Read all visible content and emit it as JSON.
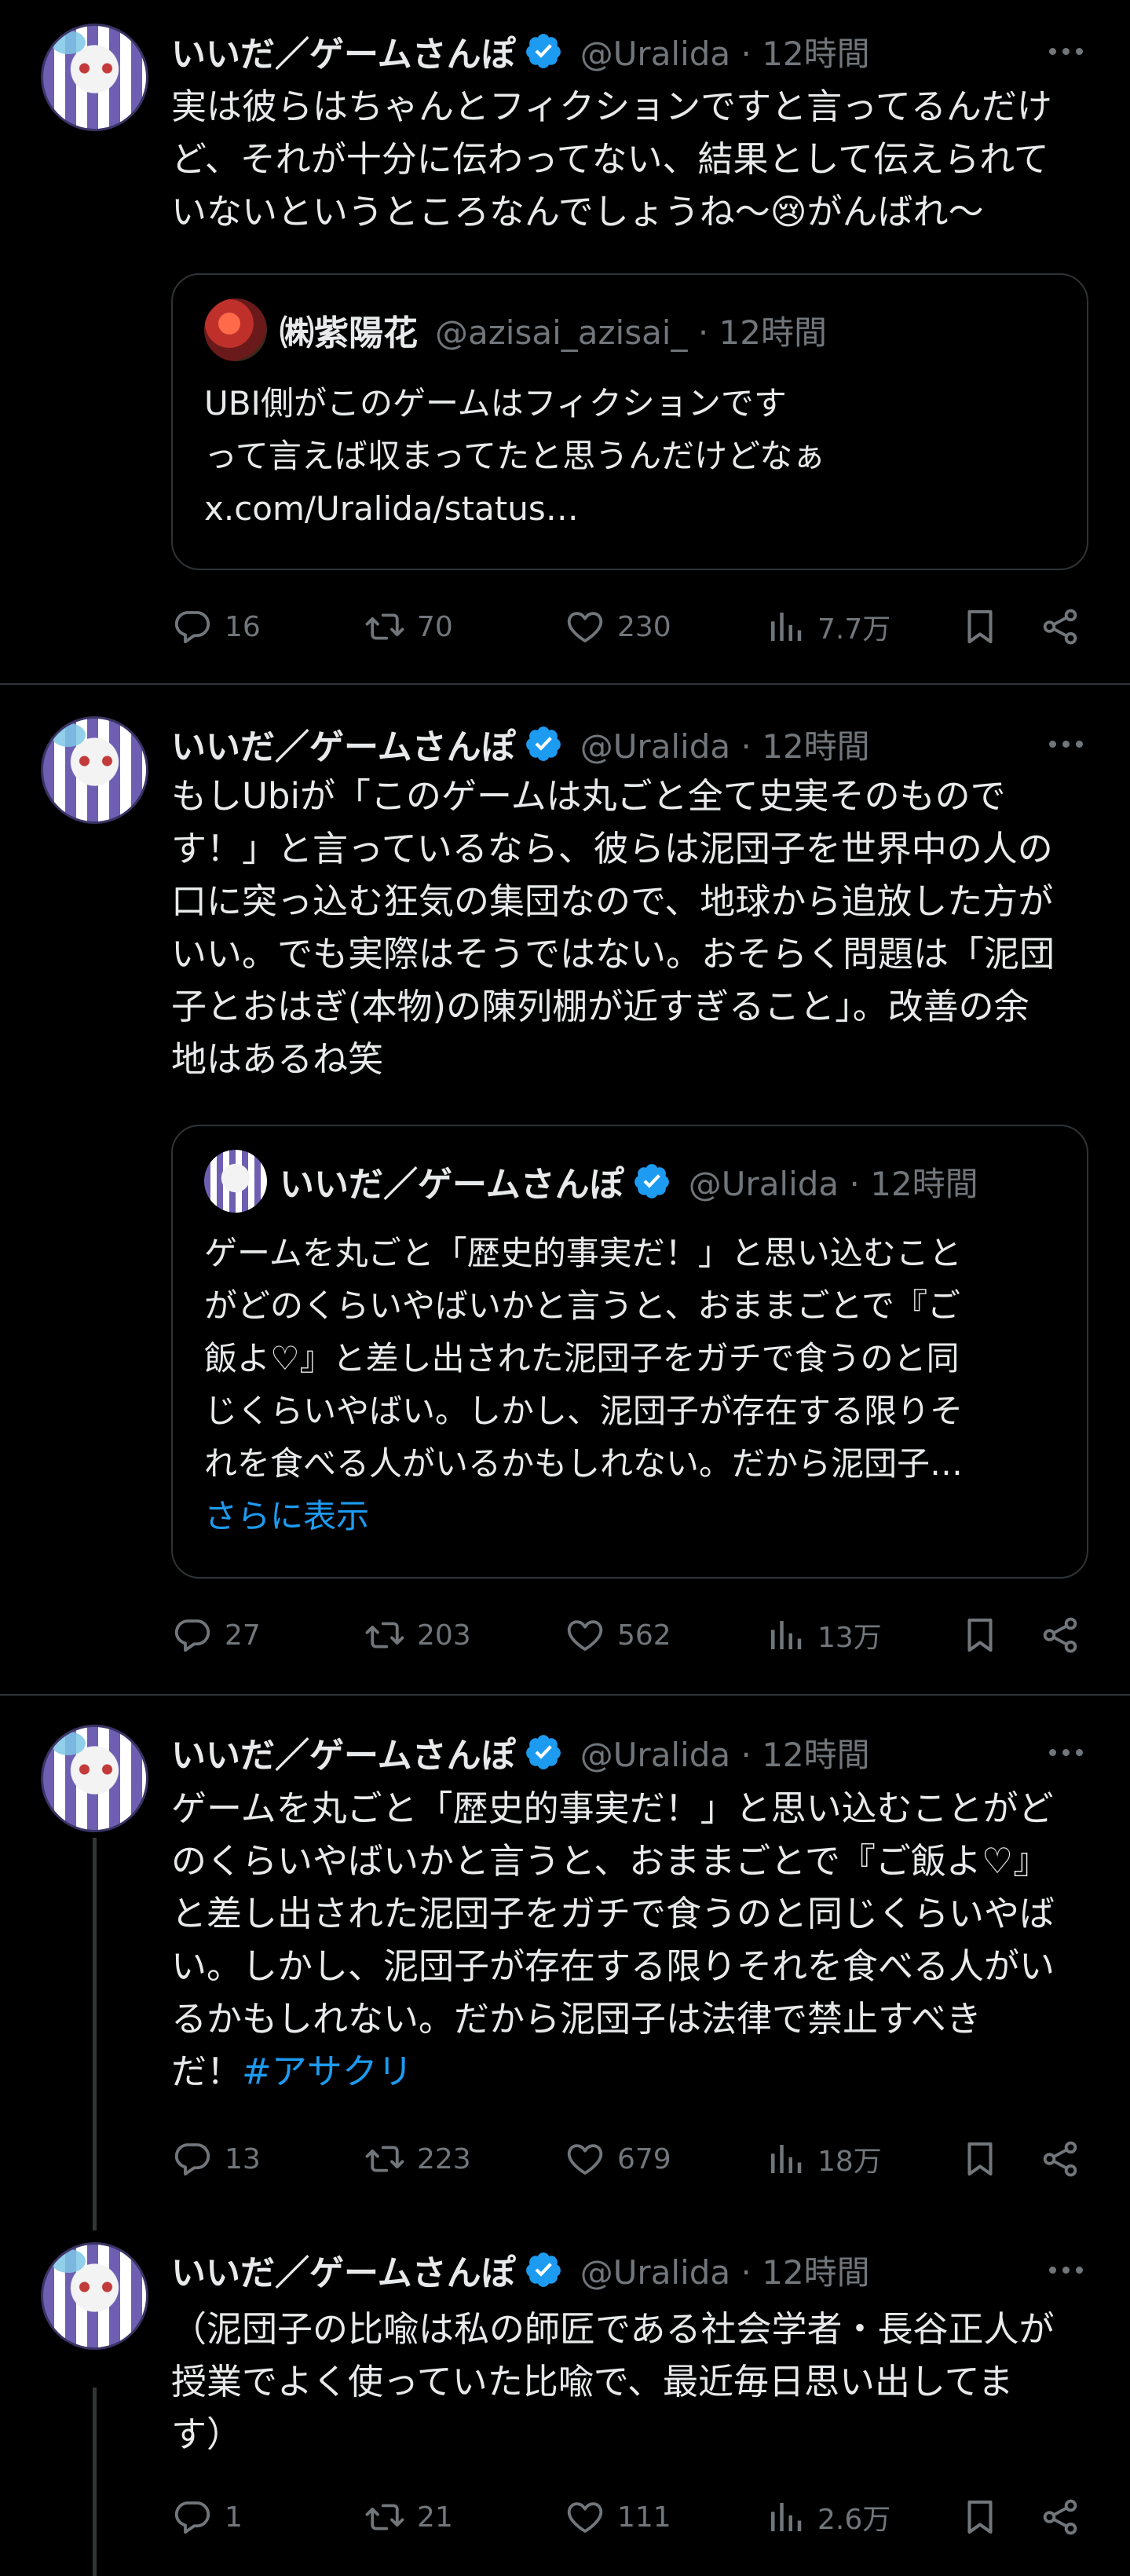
{
  "colors": {
    "background": "#000000",
    "text": "#e7e9ea",
    "secondary": "#71767b",
    "accent": "#1d9bf0",
    "border": "#2f3336"
  },
  "tweets": [
    {
      "name": "いいだ／ゲームさんぽ",
      "handle": "@Uralida · 12時間",
      "text": [
        "実は彼らはちゃんとフィクションですと言ってるんだけ",
        "ど、それが十分に伝わってない、結果として伝えられて",
        "いないというところなんでしょうね〜😢がんばれ〜"
      ],
      "quote": {
        "name": "㈱紫陽花",
        "handle": "@azisai_azisai_ · 12時間",
        "text": [
          "UBI側がこのゲームはフィクションです",
          "って言えば収まってたと思うんだけどなぁ",
          "x.com/Uralida/status…"
        ]
      },
      "stats": {
        "replies": "16",
        "retweets": "70",
        "likes": "230",
        "views": "7.7万"
      }
    },
    {
      "name": "いいだ／ゲームさんぽ",
      "handle": "@Uralida · 12時間",
      "text": [
        "もしUbiが「このゲームは丸ごと全て史実そのもので",
        "す！」と言っているなら、彼らは泥団子を世界中の人の",
        "口に突っ込む狂気の集団なので、地球から追放した方が",
        "いい。でも実際はそうではない。おそらく問題は「泥団",
        "子とおはぎ(本物)の陳列棚が近すぎること」。改善の余",
        "地はあるね笑"
      ],
      "quote": {
        "name": "いいだ／ゲームさんぽ",
        "handle": "@Uralida · 12時間",
        "text": [
          "ゲームを丸ごと「歴史的事実だ！」と思い込むこと",
          "がどのくらいやばいかと言うと、おままごとで『ご",
          "飯よ♡』と差し出された泥団子をガチで食うのと同",
          "じくらいやばい。しかし、泥団子が存在する限りそ",
          "れを食べる人がいるかもしれない。だから泥団子…"
        ],
        "show_more": "さらに表示"
      },
      "stats": {
        "replies": "27",
        "retweets": "203",
        "likes": "562",
        "views": "13万"
      }
    },
    {
      "name": "いいだ／ゲームさんぽ",
      "handle": "@Uralida · 12時間",
      "text": [
        "ゲームを丸ごと「歴史的事実だ！」と思い込むことがど",
        "のくらいやばいかと言うと、おままごとで『ご飯よ♡』",
        "と差し出された泥団子をガチで食うのと同じくらいやば",
        "い。しかし、泥団子が存在する限りそれを食べる人がい",
        "るかもしれない。だから泥団子は法律で禁止すべき",
        "だ！"
      ],
      "hashtag": "#アサクリ",
      "stats": {
        "replies": "13",
        "retweets": "223",
        "likes": "679",
        "views": "18万"
      }
    },
    {
      "name": "いいだ／ゲームさんぽ",
      "handle": "@Uralida · 12時間",
      "text": [
        "（泥団子の比喩は私の師匠である社会学者・長谷正人が",
        "授業でよく使っていた比喩で、最近毎日思い出してま",
        "す）"
      ],
      "stats": {
        "replies": "1",
        "retweets": "21",
        "likes": "111",
        "views": "2.6万"
      }
    }
  ]
}
